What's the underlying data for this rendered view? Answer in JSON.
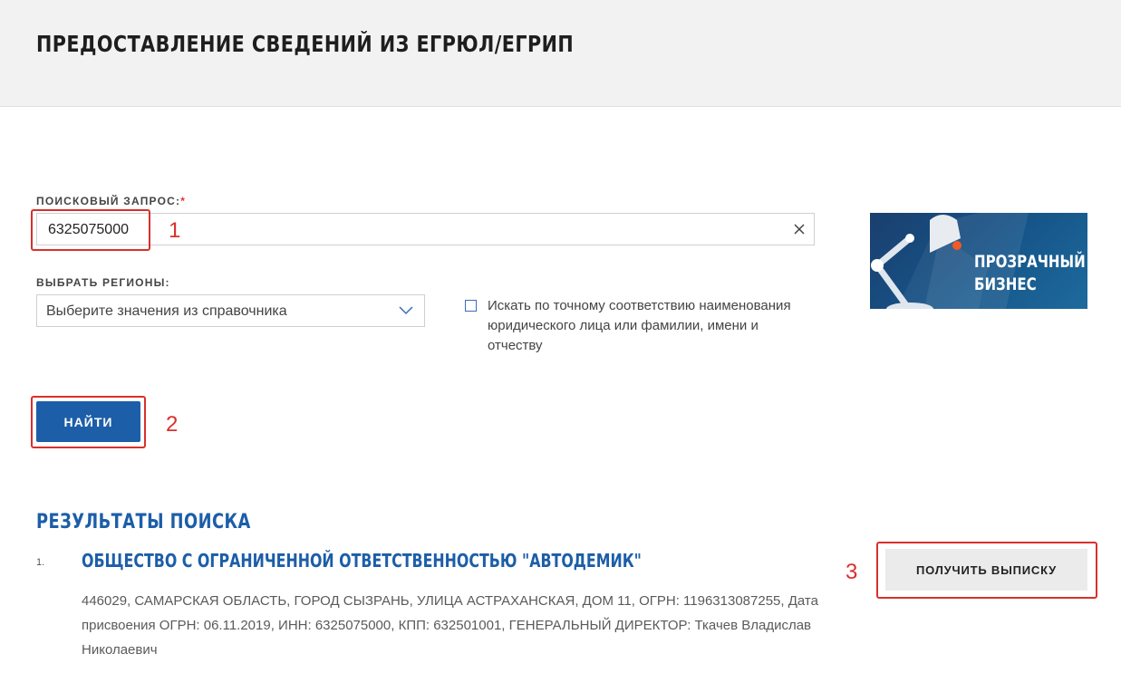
{
  "header": {
    "title": "ПРЕДОСТАВЛЕНИЕ СВЕДЕНИЙ ИЗ ЕГРЮЛ/ЕГРИП"
  },
  "search": {
    "label": "ПОИСКОВЫЙ ЗАПРОС:",
    "required_mark": "*",
    "value": "6325075000"
  },
  "regions": {
    "label": "ВЫБРАТЬ РЕГИОНЫ:",
    "selected": "Выберите значения из справочника"
  },
  "exact_match": {
    "label": "Искать по точному соответствию наименования юридического лица или фамилии, имени и отчеству",
    "checked": false
  },
  "banner": {
    "line1": "ПРОЗРАЧНЫЙ",
    "line2": "БИЗНЕС"
  },
  "find_button": {
    "label": "НАЙТИ"
  },
  "results": {
    "title": "РЕЗУЛЬТАТЫ ПОИСКА",
    "items": [
      {
        "number": "1.",
        "name": "ОБЩЕСТВО С ОГРАНИЧЕННОЙ ОТВЕТСТВЕННОСТЬЮ \"АВТОДЕМИК\"",
        "details": "446029, САМАРСКАЯ ОБЛАСТЬ, ГОРОД СЫЗРАНЬ, УЛИЦА АСТРАХАНСКАЯ, ДОМ 11, ОГРН: 1196313087255, Дата присвоения ОГРН: 06.11.2019, ИНН: 6325075000, КПП: 632501001, ГЕНЕРАЛЬНЫЙ ДИРЕКТОР: Ткачев Владислав Николаевич",
        "extract_label": "ПОЛУЧИТЬ ВЫПИСКУ"
      }
    ]
  },
  "annotations": {
    "a1": "1",
    "a2": "2",
    "a3": "3",
    "color": "#d9302c"
  },
  "colors": {
    "accent": "#1c5ea8",
    "header_bg": "#f2f2f2"
  }
}
